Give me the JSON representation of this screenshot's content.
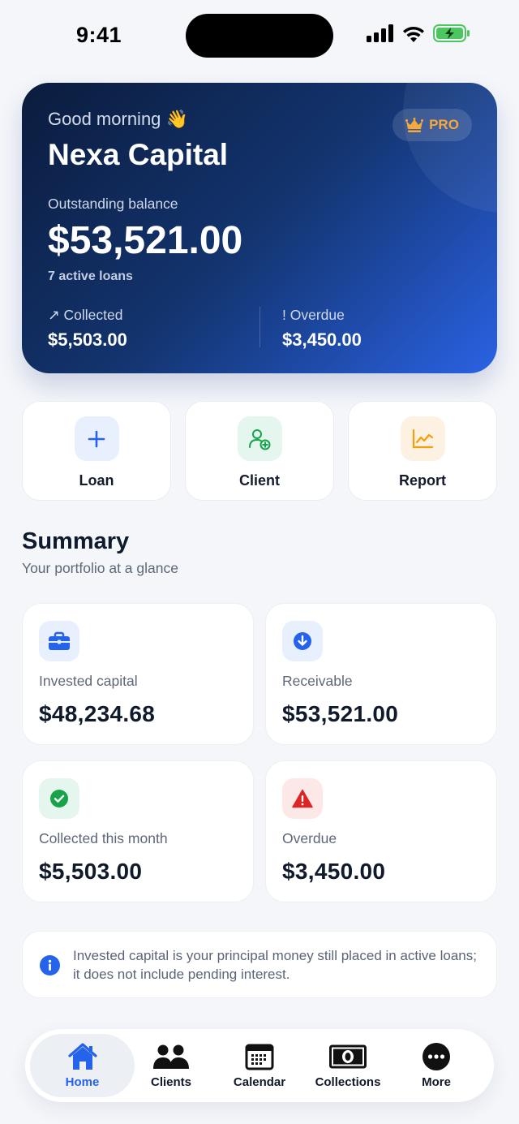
{
  "status_bar": {
    "time": "9:41"
  },
  "hero": {
    "greeting": "Good morning 👋",
    "company": "Nexa Capital",
    "badge": "PRO",
    "balance_label": "Outstanding balance",
    "balance_value": "$53,521.00",
    "active_loans": "7 active loans",
    "collected_label": "↗ Collected",
    "collected_value": "$5,503.00",
    "overdue_label": "! Overdue",
    "overdue_value": "$3,450.00"
  },
  "quick_actions": [
    {
      "label": "Loan",
      "icon": "plus-icon"
    },
    {
      "label": "Client",
      "icon": "add-user-icon"
    },
    {
      "label": "Report",
      "icon": "chart-icon"
    }
  ],
  "summary": {
    "title": "Summary",
    "subtitle": "Your portfolio at a glance",
    "cards": [
      {
        "label": "Invested capital",
        "value": "$48,234.68",
        "icon": "briefcase-icon",
        "color": "#2563eb"
      },
      {
        "label": "Receivable",
        "value": "$53,521.00",
        "icon": "arrow-down-circle-icon",
        "color": "#2563eb"
      },
      {
        "label": "Collected this month",
        "value": "$5,503.00",
        "icon": "check-circle-icon",
        "color": "#16a34a"
      },
      {
        "label": "Overdue",
        "value": "$3,450.00",
        "icon": "warning-icon",
        "color": "#dc2626"
      }
    ]
  },
  "info_note": "Invested capital is your principal money still placed in active loans; it does not include pending interest.",
  "tabs": [
    {
      "label": "Home",
      "icon": "home-icon",
      "active": true
    },
    {
      "label": "Clients",
      "icon": "users-icon"
    },
    {
      "label": "Calendar",
      "icon": "calendar-icon"
    },
    {
      "label": "Collections",
      "icon": "cash-icon"
    },
    {
      "label": "More",
      "icon": "more-icon"
    }
  ],
  "colors": {
    "accent": "#2563eb",
    "pro": "#f6a93b",
    "success": "#16a34a",
    "danger": "#dc2626",
    "hero_start": "#0b1c3d",
    "hero_end": "#2a62e3"
  }
}
